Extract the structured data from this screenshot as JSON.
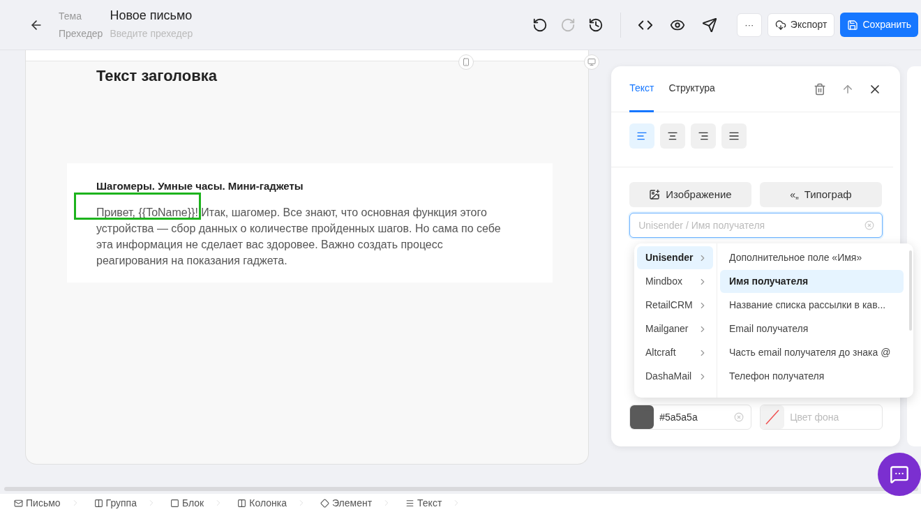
{
  "header": {
    "subject_label": "Тема",
    "title": "Новое письмо",
    "preheader_label": "Прехедер",
    "preheader_placeholder": "Введите прехедер"
  },
  "toolbar": [
    {
      "kind": "undo",
      "disabled": false
    },
    {
      "kind": "redo",
      "disabled": true
    },
    {
      "kind": "history",
      "disabled": false
    },
    {
      "kind": "code",
      "disabled": false
    },
    {
      "kind": "preview",
      "disabled": false
    },
    {
      "kind": "send",
      "disabled": false
    }
  ],
  "actions": {
    "more": "···",
    "export": "Экспорт",
    "save": "Сохранить"
  },
  "email": {
    "heading": "Текст заголовка",
    "subheading": "Шагомеры. Умные часы. Мини-гаджеты",
    "body": "Привет, {{ToName}}! Итак, шагомер. Все знают, что основная функция этого устройства — сбор данных о количестве пройденных шагов. Но сама по себе эта информация не сделает вас здоровее. Важно создать процесс реагирования на показания гаджета."
  },
  "panel": {
    "tabs": [
      {
        "label": "Текст",
        "selected": true
      },
      {
        "label": "Структура",
        "selected": false
      }
    ],
    "align": [
      {
        "kind": "left",
        "selected": true
      },
      {
        "kind": "center",
        "selected": false
      },
      {
        "kind": "right",
        "selected": false
      },
      {
        "kind": "justify",
        "selected": false
      }
    ],
    "image_button": "Изображение",
    "typograph_icon": "«„",
    "typograph_button": "Типограф",
    "variable_field": {
      "placeholder": "Unisender / Имя получателя"
    },
    "text_color": {
      "value": "#5a5a5a",
      "color": "#5a5a5a"
    },
    "bg_color": {
      "placeholder": "Цвет фона"
    }
  },
  "dropdown": {
    "providers": [
      {
        "label": "Unisender",
        "selected": true
      },
      {
        "label": "Mindbox",
        "selected": false
      },
      {
        "label": "RetailCRM",
        "selected": false
      },
      {
        "label": "Mailganer",
        "selected": false
      },
      {
        "label": "Altcraft",
        "selected": false
      },
      {
        "label": "DashaMail",
        "selected": false
      }
    ],
    "fields": [
      {
        "label": "Дополнительное поле «Имя»",
        "selected": false
      },
      {
        "label": "Имя получателя",
        "selected": true
      },
      {
        "label": "Название списка рассылки в кав...",
        "selected": false
      },
      {
        "label": "Email получателя",
        "selected": false
      },
      {
        "label": "Часть email получателя до знака @",
        "selected": false
      },
      {
        "label": "Телефон получателя",
        "selected": false
      }
    ]
  },
  "breadcrumbs": [
    {
      "kind": "letter",
      "label": "Письмо"
    },
    {
      "kind": "group",
      "label": "Группа"
    },
    {
      "kind": "block",
      "label": "Блок"
    },
    {
      "kind": "column",
      "label": "Колонка"
    },
    {
      "kind": "element",
      "label": "Элемент"
    },
    {
      "kind": "text",
      "label": "Текст"
    }
  ]
}
